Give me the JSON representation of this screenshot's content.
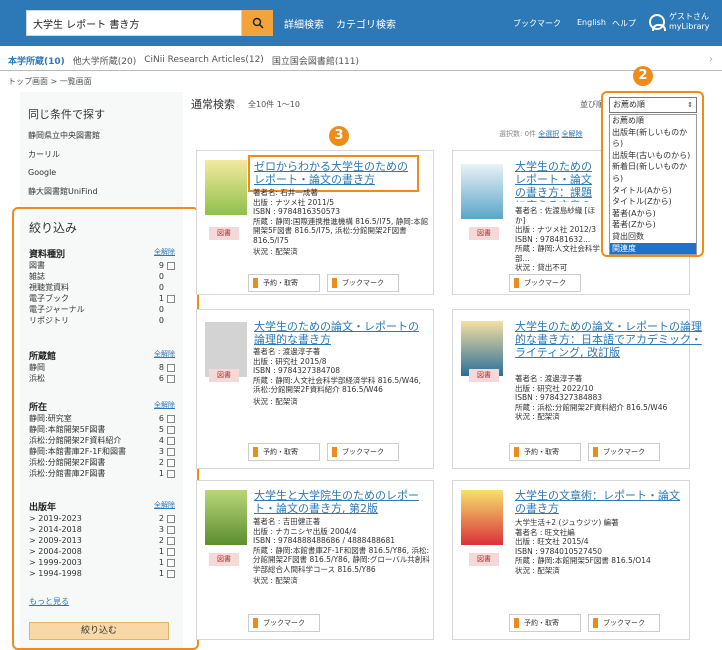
{
  "header": {
    "search_value": "大学生 レポート 書き方",
    "adv_search": "詳細検索",
    "category_search": "カテゴリ検索",
    "bookmark": "ブックマーク",
    "english": "English",
    "help": "ヘルプ",
    "guest_line1": "ゲストさん",
    "guest_line2": "myLibrary"
  },
  "tabs": [
    "本学所蔵(10)",
    "他大学所蔵(20)",
    "CiNii Research Articles(12)",
    "国立国会図書館(111)"
  ],
  "breadcrumb": "トップ画面 > 一覧画面",
  "sidebar": {
    "same_title": "同じ条件で探す",
    "same_links": [
      "静岡県立中央図書館",
      "カーリル",
      "Google",
      "静大図書館UniFind"
    ],
    "filter_title": "絞り込み",
    "clear_label": "全解除",
    "groups": [
      {
        "title": "資料種別",
        "rows": [
          [
            "図書",
            "9"
          ],
          [
            "雑誌",
            "0"
          ],
          [
            "視聴覚資料",
            "0"
          ],
          [
            "電子ブック",
            "1"
          ],
          [
            "電子ジャーナル",
            "0"
          ],
          [
            "リポジトリ",
            "0"
          ]
        ]
      },
      {
        "title": "所蔵館",
        "rows": [
          [
            "静岡",
            "8"
          ],
          [
            "浜松",
            "6"
          ]
        ]
      },
      {
        "title": "所在",
        "rows": [
          [
            "静岡:研究室",
            "6"
          ],
          [
            "静岡:本館開架5F図書",
            "5"
          ],
          [
            "浜松:分館開架2F資料紹介",
            "4"
          ],
          [
            "静岡:本館書庫2F-1F和図書",
            "3"
          ],
          [
            "浜松:分館開架2F図書",
            "2"
          ],
          [
            "浜松:分館書庫2F図書",
            "1"
          ]
        ]
      },
      {
        "title": "出版年",
        "rows": [
          [
            "> 2019-2023",
            "2"
          ],
          [
            "> 2014-2018",
            "3"
          ],
          [
            "> 2009-2013",
            "2"
          ],
          [
            "> 2004-2008",
            "1"
          ],
          [
            "> 1999-2003",
            "1"
          ],
          [
            "> 1994-1998",
            "1"
          ]
        ]
      }
    ],
    "more": "もっと見る",
    "narrow_button": "絞り込む"
  },
  "main": {
    "title": "通常検索",
    "count": "全10件 1〜10",
    "sort_label": "並び順",
    "selection_prefix": "選択数: 0件",
    "select_all": "全選択",
    "clear_all": "全解除",
    "sort_selected": "お薦め順",
    "sort_options": [
      "お薦め順",
      "出版年(新しいものから)",
      "出版年(古いものから)",
      "新着日(新しいものから)",
      "タイトル(Aから)",
      "タイトル(Zから)",
      "著者(Aから)",
      "著者(Zから)",
      "貸出回数",
      "関連度"
    ],
    "badge2": "2",
    "badge3": "3",
    "tag": "図書",
    "reserve": "予約・取寄",
    "bookmark": "ブックマーク",
    "books": [
      {
        "title": "ゼロからわかる大学生のためのレポート・論文の書き方",
        "l1": "著者名: 石井一成著",
        "l2": "出版 : ナツメ社 2011/5",
        "l3": "ISBN : 9784816350573",
        "l4": "所蔵 : 静岡:国際連携推進機構 816.5/I75, 静岡:本館開架5F図書 816.5/I75, 浜松:分館開架2F図書 816.5/I75",
        "l5": "状況 : 配架済"
      },
      {
        "title": "大学生のためのレポート・論文の書き方：課題に応える文章の書き方",
        "l1": "著者名 : 佐渡島紗織 [ほか]",
        "l2": "出版 : ナツメ社 2012/3",
        "l3": "ISBN : 978481632...",
        "l4": "所蔵 : 静岡:人文社会科学部...",
        "l5": "状況 : 貸出不可"
      },
      {
        "title": "大学生のための論文・レポートの論理的な書き方",
        "l1": "著者名 : 渡邊淳子著",
        "l2": "出版 : 研究社 2015/8",
        "l3": "ISBN : 9784327384708",
        "l4": "所蔵 : 静岡:人文社会科学部経済学科 816.5/W46, 浜松:分館開架2F資料紹介 816.5/W46",
        "l5": "状況 : 配架済"
      },
      {
        "title": "大学生のための論文・レポートの論理的な書き方：日本語でアカデミック・ライティング, 改訂版",
        "l1": "著者名 : 渡邊淳子著",
        "l2": "出版 : 研究社 2022/10",
        "l3": "ISBN : 9784327384883",
        "l4": "所蔵 : 浜松:分館開架2F資料紹介 816.5/W46",
        "l5": "状況 : 配架済"
      },
      {
        "title": "大学生と大学院生のためのレポート・論文の書き方, 第2版",
        "l1": "著者名 : 吉田健正著",
        "l2": "出版 : ナカニシヤ出版 2004/4",
        "l3": "ISBN : 9784888488686 / 4888488681",
        "l4": "所蔵 : 静岡:本館書庫2F-1F和図書 816.5/Y86, 浜松:分館開架2F図書 816.5/Y86, 静岡:グローバル共創科学部総合人間科学コース 816.5/Y86",
        "l5": "状況 : 配架済"
      },
      {
        "title": "大学生の文章術：レポート・論文の書き方",
        "l1": "大学生活+2 (ジュウジツ) 編著",
        "l2": "著者名 : 旺文社編",
        "l3": "出版 : 旺文社 2015/4",
        "l4": "ISBN : 9784010527450",
        "l5": "所蔵 : 静岡:本館開架5F図書 816.5/O14",
        "l6": "状況 : 配架済"
      }
    ]
  },
  "colors": {
    "header": "#2d79b8",
    "accent": "#ef8b1b"
  }
}
